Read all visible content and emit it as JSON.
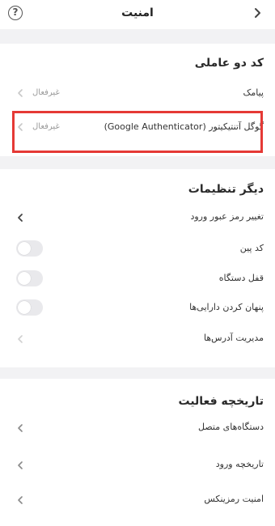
{
  "header": {
    "title": "امنیت",
    "help_icon": "?"
  },
  "two_factor": {
    "title": "کد دو عاملی",
    "sms": {
      "label": "پیامک",
      "status": "غیرفعال"
    },
    "google_auth": {
      "label": "گوگل آتنتیکیتور (Google Authenticator)",
      "status": "غیرفعال"
    },
    "highlight_color": "#e53935"
  },
  "other_settings": {
    "title": "دیگر تنظیمات",
    "items": [
      {
        "label": "تغییر رمز عبور ورود",
        "type": "link"
      },
      {
        "label": "کد پین",
        "type": "toggle"
      },
      {
        "label": "قفل دستگاه",
        "type": "toggle"
      },
      {
        "label": "پنهان کردن دارایی‌ها",
        "type": "toggle"
      },
      {
        "label": "مدیریت آدرس‌ها",
        "type": "link"
      }
    ]
  },
  "activity": {
    "title": "تاریخچه فعالیت",
    "items": [
      {
        "label": "دستگاه‌های متصل"
      },
      {
        "label": "تاریخچه ورود"
      },
      {
        "label": "امنیت رمزینکس"
      }
    ]
  }
}
